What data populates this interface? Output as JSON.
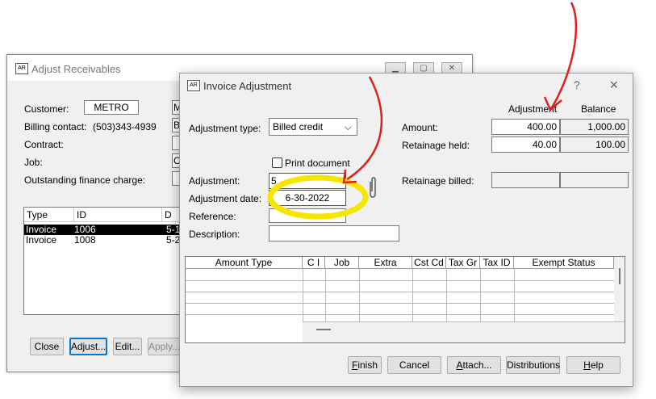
{
  "back_window": {
    "title": "Adjust Receivables",
    "icon": "app-icon",
    "labels": {
      "customer": "Customer:",
      "billing_contact": "Billing contact:",
      "contract": "Contract:",
      "job": "Job:",
      "outstanding": "Outstanding finance charge:"
    },
    "customer_value": "METRO",
    "billing_phone": "(503)343-4939",
    "clipped_letters": [
      "M",
      "B",
      "",
      "C",
      ""
    ],
    "list": {
      "headers": [
        "Type",
        "ID",
        "D"
      ],
      "rows": [
        {
          "type": "Invoice",
          "id": "1006",
          "date": "5-1"
        },
        {
          "type": "Invoice",
          "id": "1008",
          "date": "5-2"
        }
      ]
    },
    "buttons": {
      "close": "Close",
      "adjust": "Adjust...",
      "edit": "Edit...",
      "apply": "Apply..."
    }
  },
  "front_window": {
    "title": "Invoice Adjustment",
    "help_glyph": "?",
    "close_glyph": "✕",
    "labels": {
      "adjustment_type": "Adjustment type:",
      "adjustment": "Adjustment:",
      "adjustment_date": "Adjustment date:",
      "reference": "Reference:",
      "description": "Description:",
      "print_document": "Print document",
      "amount": "Amount:",
      "retainage_held": "Retainage held:",
      "retainage_billed": "Retainage billed:",
      "col_adjustment": "Adjustment",
      "col_balance": "Balance"
    },
    "adjustment_type_value": "Billed credit",
    "adjustment_value": "5",
    "adjustment_date_value": "6-30-2022",
    "reference_value": "",
    "description_value": "",
    "amount_adjustment": "400.00",
    "amount_balance": "1,000.00",
    "retainage_held_adjustment": "40.00",
    "retainage_held_balance": "100.00",
    "retainage_billed_adjustment": "",
    "retainage_billed_balance": "",
    "grid_headers": [
      "Amount Type",
      "C I",
      "Job",
      "Extra",
      "Cst Cd",
      "Tax Gr",
      "Tax ID",
      "Exempt Status"
    ],
    "buttons": {
      "finish": "Finish",
      "cancel": "Cancel",
      "attach": "Attach...",
      "distributions": "Distributions",
      "help": "Help"
    }
  },
  "annotation_colors": {
    "highlight": "#f5e600",
    "arrow": "#e02020"
  }
}
